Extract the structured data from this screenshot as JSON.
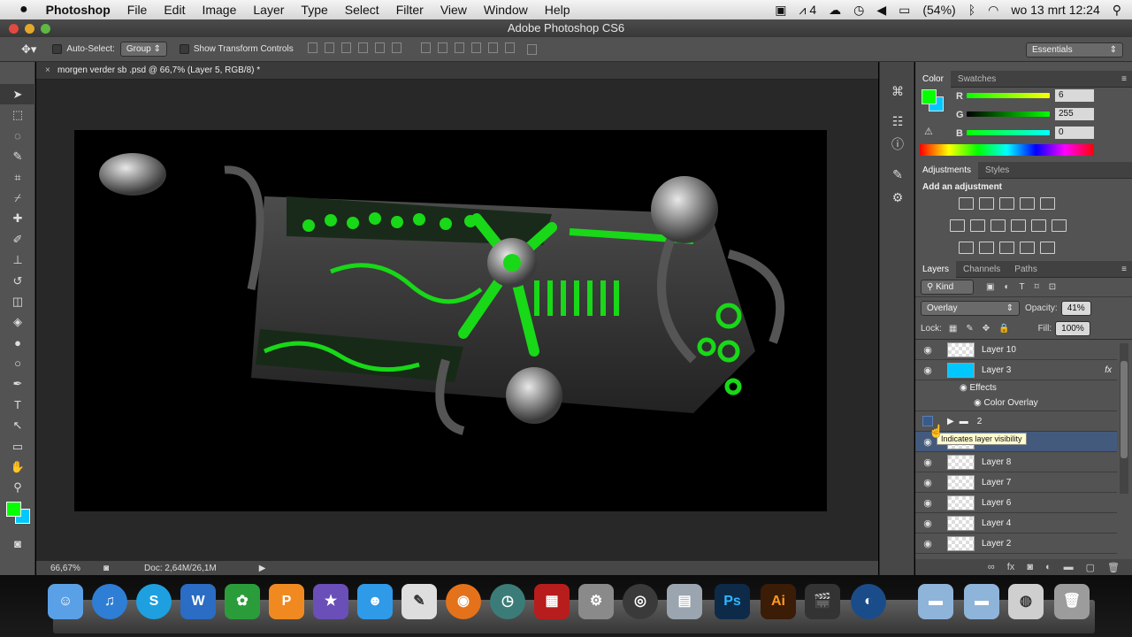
{
  "menubar": {
    "apple": "",
    "app": "Photoshop",
    "items": [
      "File",
      "Edit",
      "Image",
      "Layer",
      "Type",
      "Select",
      "Filter",
      "View",
      "Window",
      "Help"
    ],
    "status": {
      "dropbox_count": "4",
      "battery": "(54%)",
      "datetime": "wo 13 mrt  12:24"
    }
  },
  "window": {
    "title": "Adobe Photoshop CS6"
  },
  "options": {
    "auto_select_label": "Auto-Select:",
    "auto_select_value": "Group",
    "transform_label": "Show Transform Controls",
    "workspace": "Essentials"
  },
  "document": {
    "tab_title": "morgen verder sb .psd @ 66,7% (Layer 5, RGB/8) *",
    "zoom": "66,67%",
    "doc_size": "Doc: 2,64M/26,1M"
  },
  "color_panel": {
    "tabs": [
      "Color",
      "Swatches"
    ],
    "r_label": "R",
    "g_label": "G",
    "b_label": "B",
    "r": "6",
    "g": "255",
    "b": "0",
    "fg_color": "#06ff00",
    "bg_color": "#00c8ff"
  },
  "adjustments_panel": {
    "tabs": [
      "Adjustments",
      "Styles"
    ],
    "heading": "Add an adjustment"
  },
  "layers_panel": {
    "tabs": [
      "Layers",
      "Channels",
      "Paths"
    ],
    "filter": "Kind",
    "blend_mode": "Overlay",
    "opacity_label": "Opacity:",
    "opacity": "41%",
    "lock_label": "Lock:",
    "fill_label": "Fill:",
    "fill": "100%",
    "layers": [
      {
        "name": "Layer 10",
        "type": "layer",
        "visible": true
      },
      {
        "name": "Layer 3",
        "type": "layer",
        "visible": true,
        "fx": "fx",
        "thumb": "cyan"
      },
      {
        "name": "Effects",
        "type": "effects"
      },
      {
        "name": "Color Overlay",
        "type": "effect"
      },
      {
        "name": "2",
        "type": "group",
        "visible": false
      },
      {
        "name": "",
        "type": "selected",
        "visible": true
      },
      {
        "name": "Layer 8",
        "type": "layer",
        "visible": true
      },
      {
        "name": "Layer 7",
        "type": "layer",
        "visible": true
      },
      {
        "name": "Layer 6",
        "type": "layer",
        "visible": true
      },
      {
        "name": "Layer 4",
        "type": "layer",
        "visible": true
      },
      {
        "name": "Layer 2",
        "type": "layer",
        "visible": true
      }
    ],
    "tooltip": "Indicates layer visibility"
  },
  "dock": {
    "items": [
      "Finder",
      "iTunes",
      "Skype",
      "Word",
      "Wiki",
      "Pages",
      "iMovie",
      "Messenger",
      "Pencil",
      "Firefox",
      "Time Machine",
      "Photo Booth",
      "System Preferences",
      "Aperture",
      "Preview",
      "Ps",
      "Ai",
      "Final Cut",
      "Cinema 4D",
      "Folder",
      "Folder",
      "Browser",
      "Trash"
    ]
  }
}
